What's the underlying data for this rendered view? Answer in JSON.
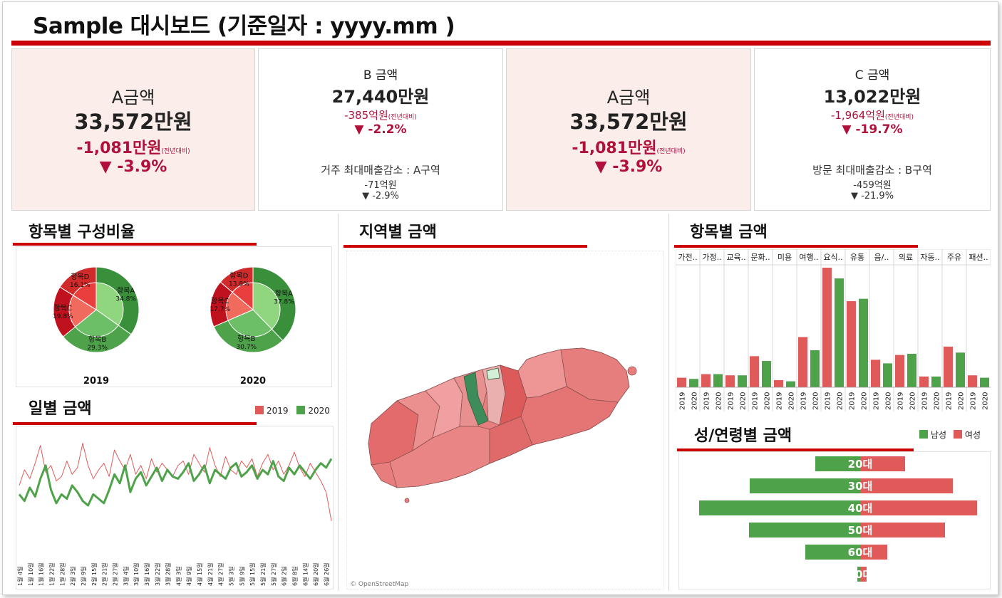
{
  "header": {
    "title": "Sample 대시보드 (기준일자 : yyyy.mm )"
  },
  "kpis": [
    {
      "label": "A금액",
      "value": "33,572만원",
      "diff": "-1,081만원",
      "diff_note": "(전년대비)",
      "pct": "▼ -3.9%"
    },
    {
      "label": "B 금액",
      "value": "27,440만원",
      "diff": "-385억원",
      "diff_note": "(전년대비)",
      "pct": "▼ -2.2%",
      "note_title": "거주 최대매출감소 :  A구역",
      "note_value": "-71억원",
      "note_pct": "▼ -2.9%"
    },
    {
      "label": "A금액",
      "value": "33,572만원",
      "diff": "-1,081만원",
      "diff_note": "(전년대비)",
      "pct": "▼ -3.9%"
    },
    {
      "label": "C 금액",
      "value": "13,022만원",
      "diff": "-1,964억원",
      "diff_note": "(전년대비)",
      "pct": "▼ -19.7%",
      "note_title": "방문 최대매출감소 : B구역",
      "note_value": "-459억원",
      "note_pct": "▼ -21.9%"
    }
  ],
  "sections": {
    "composition": "항목별 구성비율",
    "daily": "일별 금액",
    "region": "지역별 금액",
    "items": "항목별 금액",
    "gender_age": "성/연령별 금액"
  },
  "map": {
    "attribution": "© OpenStreetMap"
  },
  "colors": {
    "accent": "#cc0000",
    "red": "#e05a5a",
    "green": "#4ea24a",
    "dark_red": "#c0121e",
    "dark_green": "#3a8f3a",
    "light_green": "#8fd67f",
    "light_red": "#f06a5e"
  },
  "chart_data": [
    {
      "id": "donut-2019",
      "type": "pie",
      "label": "2019",
      "slices": [
        {
          "name": "항목A",
          "value": 34.8,
          "label": "34.8%"
        },
        {
          "name": "항목B",
          "value": 29.3,
          "label": "29.3%"
        },
        {
          "name": "항목C",
          "value": 19.8,
          "label": "19.8%"
        },
        {
          "name": "항목D",
          "value": 16.1,
          "label": "16.1%"
        }
      ]
    },
    {
      "id": "donut-2020",
      "type": "pie",
      "label": "2020",
      "slices": [
        {
          "name": "항목A",
          "value": 37.8,
          "label": "37.8%"
        },
        {
          "name": "항목B",
          "value": 30.7,
          "label": "30.7%"
        },
        {
          "name": "항목C",
          "value": 17.7,
          "label": "17.7%"
        },
        {
          "name": "항목D",
          "value": 13.8,
          "label": "13.8%"
        }
      ]
    },
    {
      "id": "daily",
      "type": "line",
      "legend": [
        "2019",
        "2020"
      ],
      "x": [
        "1월 4일",
        "1월 10일",
        "1월 16일",
        "1월 22일",
        "1월 28일",
        "2월 3일",
        "2월 9일",
        "2월 15일",
        "2월 21일",
        "2월 27일",
        "3월 4일",
        "3월 10일",
        "3월 16일",
        "3월 22일",
        "3월 28일",
        "4월 3일",
        "4월 9일",
        "4월 15일",
        "4월 21일",
        "4월 27일",
        "5월 3일",
        "5월 9일",
        "5월 15일",
        "5월 21일",
        "5월 27일",
        "6월 2일",
        "6월 8일",
        "6월 14일",
        "6월 20일",
        "6월 26일"
      ],
      "series": [
        {
          "name": "2019",
          "values": [
            52,
            66,
            58,
            72,
            88,
            64,
            70,
            56,
            60,
            74,
            62,
            68,
            90,
            70,
            58,
            66,
            72,
            60,
            84,
            74,
            66,
            80,
            62,
            70,
            58,
            76,
            64,
            72,
            66,
            60,
            70,
            74,
            62,
            80,
            72,
            64,
            86,
            70,
            60,
            78,
            66,
            62,
            74,
            68,
            76,
            60,
            72,
            80,
            66,
            74,
            62,
            70,
            82,
            68,
            60,
            72,
            64,
            56,
            46,
            20
          ]
        },
        {
          "name": "2020",
          "values": [
            44,
            38,
            50,
            42,
            58,
            70,
            48,
            36,
            44,
            40,
            52,
            46,
            38,
            34,
            44,
            40,
            36,
            48,
            62,
            54,
            70,
            46,
            58,
            64,
            52,
            60,
            68,
            56,
            66,
            60,
            58,
            64,
            72,
            56,
            62,
            70,
            54,
            66,
            62,
            58,
            68,
            72,
            60,
            64,
            70,
            58,
            66,
            62,
            74,
            60,
            56,
            68,
            62,
            70,
            64,
            58,
            66,
            72,
            68,
            76
          ]
        }
      ]
    },
    {
      "id": "items",
      "type": "bar",
      "categories": [
        "가전..",
        "가정..",
        "교육..",
        "문화..",
        "미용",
        "여행..",
        "요식..",
        "유통",
        "음/..",
        "의료",
        "자동..",
        "주유",
        "패션.."
      ],
      "series": [
        {
          "name": "2019",
          "values": [
            8,
            11,
            10,
            26,
            6,
            42,
            100,
            72,
            23,
            27,
            9,
            34,
            10
          ]
        },
        {
          "name": "2020",
          "values": [
            7,
            11,
            10,
            22,
            5,
            31,
            91,
            74,
            20,
            28,
            9,
            29,
            8
          ]
        }
      ],
      "ylim": [
        0,
        100
      ]
    },
    {
      "id": "gender-age",
      "type": "bar",
      "orientation": "horizontal",
      "legend": [
        "남성",
        "여성"
      ],
      "categories": [
        "20대",
        "30대",
        "40대",
        "50대",
        "60대",
        "70대"
      ],
      "series": [
        {
          "name": "남성",
          "values": [
            63,
            155,
            226,
            156,
            77,
            4
          ]
        },
        {
          "name": "여성",
          "values": [
            63,
            130,
            164,
            119,
            38,
            9
          ]
        }
      ]
    }
  ]
}
